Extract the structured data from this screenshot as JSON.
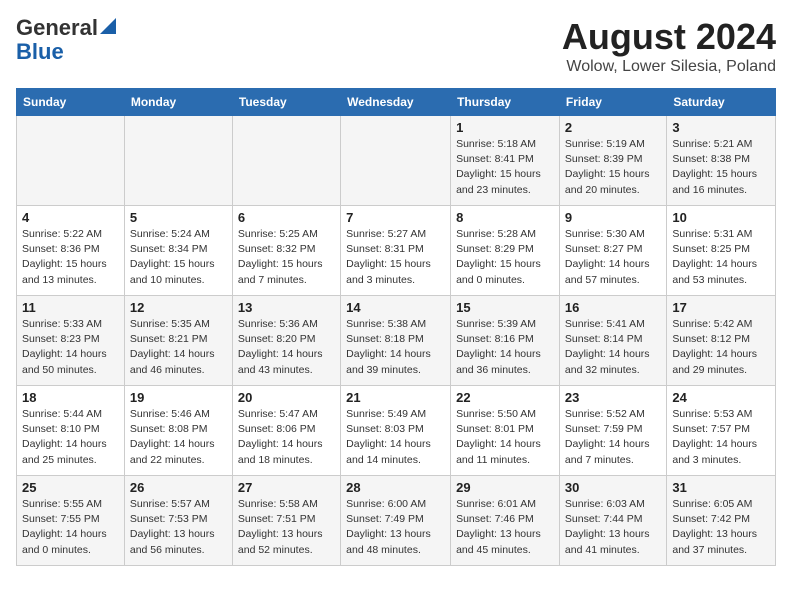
{
  "header": {
    "logo_general": "General",
    "logo_blue": "Blue",
    "month_title": "August 2024",
    "location": "Wolow, Lower Silesia, Poland"
  },
  "columns": [
    "Sunday",
    "Monday",
    "Tuesday",
    "Wednesday",
    "Thursday",
    "Friday",
    "Saturday"
  ],
  "weeks": [
    [
      {
        "day": "",
        "info": ""
      },
      {
        "day": "",
        "info": ""
      },
      {
        "day": "",
        "info": ""
      },
      {
        "day": "",
        "info": ""
      },
      {
        "day": "1",
        "info": "Sunrise: 5:18 AM\nSunset: 8:41 PM\nDaylight: 15 hours\nand 23 minutes."
      },
      {
        "day": "2",
        "info": "Sunrise: 5:19 AM\nSunset: 8:39 PM\nDaylight: 15 hours\nand 20 minutes."
      },
      {
        "day": "3",
        "info": "Sunrise: 5:21 AM\nSunset: 8:38 PM\nDaylight: 15 hours\nand 16 minutes."
      }
    ],
    [
      {
        "day": "4",
        "info": "Sunrise: 5:22 AM\nSunset: 8:36 PM\nDaylight: 15 hours\nand 13 minutes."
      },
      {
        "day": "5",
        "info": "Sunrise: 5:24 AM\nSunset: 8:34 PM\nDaylight: 15 hours\nand 10 minutes."
      },
      {
        "day": "6",
        "info": "Sunrise: 5:25 AM\nSunset: 8:32 PM\nDaylight: 15 hours\nand 7 minutes."
      },
      {
        "day": "7",
        "info": "Sunrise: 5:27 AM\nSunset: 8:31 PM\nDaylight: 15 hours\nand 3 minutes."
      },
      {
        "day": "8",
        "info": "Sunrise: 5:28 AM\nSunset: 8:29 PM\nDaylight: 15 hours\nand 0 minutes."
      },
      {
        "day": "9",
        "info": "Sunrise: 5:30 AM\nSunset: 8:27 PM\nDaylight: 14 hours\nand 57 minutes."
      },
      {
        "day": "10",
        "info": "Sunrise: 5:31 AM\nSunset: 8:25 PM\nDaylight: 14 hours\nand 53 minutes."
      }
    ],
    [
      {
        "day": "11",
        "info": "Sunrise: 5:33 AM\nSunset: 8:23 PM\nDaylight: 14 hours\nand 50 minutes."
      },
      {
        "day": "12",
        "info": "Sunrise: 5:35 AM\nSunset: 8:21 PM\nDaylight: 14 hours\nand 46 minutes."
      },
      {
        "day": "13",
        "info": "Sunrise: 5:36 AM\nSunset: 8:20 PM\nDaylight: 14 hours\nand 43 minutes."
      },
      {
        "day": "14",
        "info": "Sunrise: 5:38 AM\nSunset: 8:18 PM\nDaylight: 14 hours\nand 39 minutes."
      },
      {
        "day": "15",
        "info": "Sunrise: 5:39 AM\nSunset: 8:16 PM\nDaylight: 14 hours\nand 36 minutes."
      },
      {
        "day": "16",
        "info": "Sunrise: 5:41 AM\nSunset: 8:14 PM\nDaylight: 14 hours\nand 32 minutes."
      },
      {
        "day": "17",
        "info": "Sunrise: 5:42 AM\nSunset: 8:12 PM\nDaylight: 14 hours\nand 29 minutes."
      }
    ],
    [
      {
        "day": "18",
        "info": "Sunrise: 5:44 AM\nSunset: 8:10 PM\nDaylight: 14 hours\nand 25 minutes."
      },
      {
        "day": "19",
        "info": "Sunrise: 5:46 AM\nSunset: 8:08 PM\nDaylight: 14 hours\nand 22 minutes."
      },
      {
        "day": "20",
        "info": "Sunrise: 5:47 AM\nSunset: 8:06 PM\nDaylight: 14 hours\nand 18 minutes."
      },
      {
        "day": "21",
        "info": "Sunrise: 5:49 AM\nSunset: 8:03 PM\nDaylight: 14 hours\nand 14 minutes."
      },
      {
        "day": "22",
        "info": "Sunrise: 5:50 AM\nSunset: 8:01 PM\nDaylight: 14 hours\nand 11 minutes."
      },
      {
        "day": "23",
        "info": "Sunrise: 5:52 AM\nSunset: 7:59 PM\nDaylight: 14 hours\nand 7 minutes."
      },
      {
        "day": "24",
        "info": "Sunrise: 5:53 AM\nSunset: 7:57 PM\nDaylight: 14 hours\nand 3 minutes."
      }
    ],
    [
      {
        "day": "25",
        "info": "Sunrise: 5:55 AM\nSunset: 7:55 PM\nDaylight: 14 hours\nand 0 minutes."
      },
      {
        "day": "26",
        "info": "Sunrise: 5:57 AM\nSunset: 7:53 PM\nDaylight: 13 hours\nand 56 minutes."
      },
      {
        "day": "27",
        "info": "Sunrise: 5:58 AM\nSunset: 7:51 PM\nDaylight: 13 hours\nand 52 minutes."
      },
      {
        "day": "28",
        "info": "Sunrise: 6:00 AM\nSunset: 7:49 PM\nDaylight: 13 hours\nand 48 minutes."
      },
      {
        "day": "29",
        "info": "Sunrise: 6:01 AM\nSunset: 7:46 PM\nDaylight: 13 hours\nand 45 minutes."
      },
      {
        "day": "30",
        "info": "Sunrise: 6:03 AM\nSunset: 7:44 PM\nDaylight: 13 hours\nand 41 minutes."
      },
      {
        "day": "31",
        "info": "Sunrise: 6:05 AM\nSunset: 7:42 PM\nDaylight: 13 hours\nand 37 minutes."
      }
    ]
  ]
}
